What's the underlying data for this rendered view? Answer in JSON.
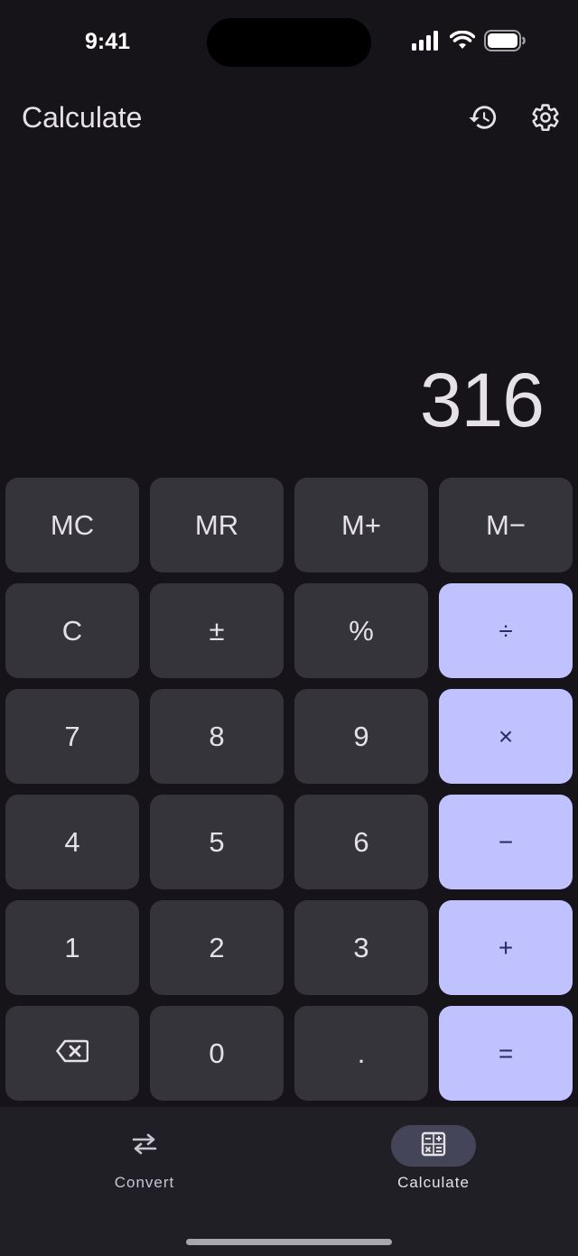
{
  "status_bar": {
    "time": "9:41",
    "icons": [
      "signal-icon",
      "wifi-icon",
      "battery-icon"
    ]
  },
  "header": {
    "title": "Calculate",
    "actions": [
      "history-icon",
      "settings-gear-icon"
    ]
  },
  "display": {
    "value": "316"
  },
  "keypad": {
    "rows": [
      [
        "MC",
        "MR",
        "M+",
        "M−"
      ],
      [
        "C",
        "±",
        "%",
        "÷"
      ],
      [
        "7",
        "8",
        "9",
        "×"
      ],
      [
        "4",
        "5",
        "6",
        "−"
      ],
      [
        "1",
        "2",
        "3",
        "+"
      ],
      [
        "",
        "0",
        ".",
        "="
      ]
    ],
    "backspace_icon": "backspace-icon"
  },
  "bottom_nav": {
    "items": [
      {
        "label": "Convert",
        "icon": "swap-arrows-icon",
        "selected": false
      },
      {
        "label": "Calculate",
        "icon": "calculator-icon",
        "selected": true
      }
    ]
  },
  "colors": {
    "background": "#161419",
    "key": "#36343b",
    "operator_key": "#bfc2ff",
    "operator_text": "#292c61",
    "nav_background": "#211f26",
    "nav_selected_pill": "#454559"
  }
}
